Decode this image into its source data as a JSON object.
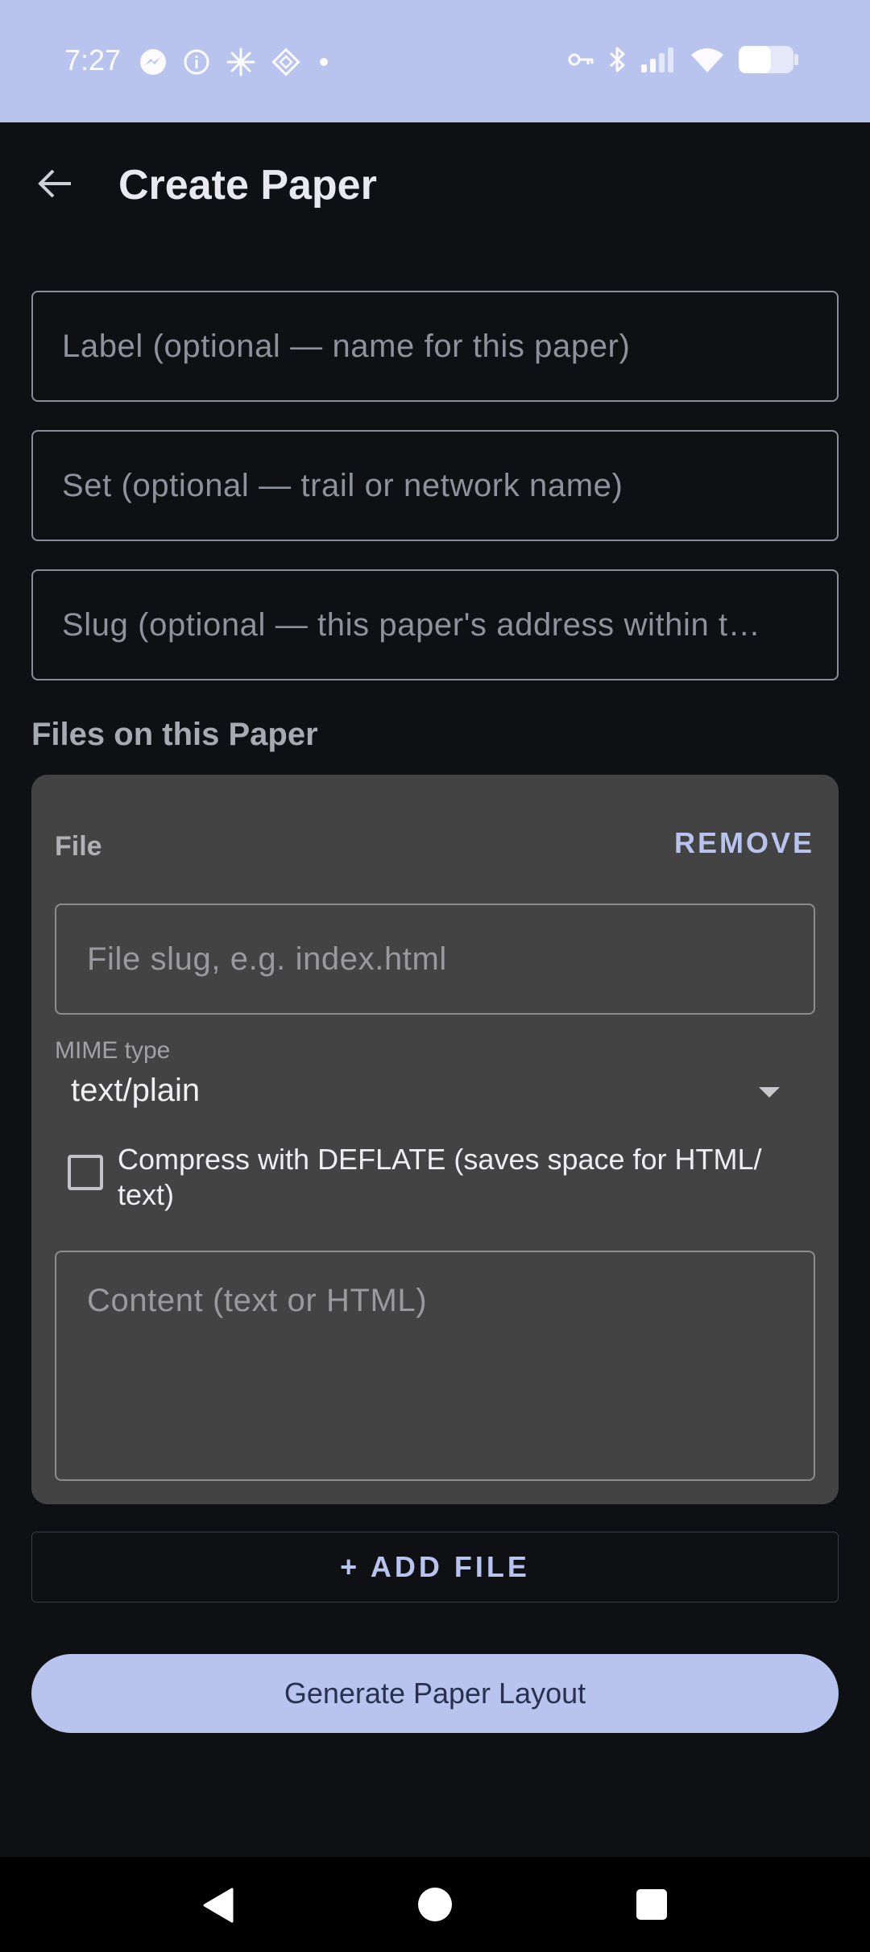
{
  "status_bar": {
    "time": "7:27",
    "left_icons": [
      "messenger-icon",
      "info-icon",
      "sparkle-icon",
      "diamond-icon",
      "dot-icon"
    ],
    "right_icons": [
      "vpn-key-icon",
      "bluetooth-icon",
      "signal-icon",
      "wifi-icon",
      "battery-icon"
    ]
  },
  "app_bar": {
    "title": "Create Paper",
    "back_icon": "arrow-left-icon"
  },
  "form": {
    "label_placeholder": "Label (optional — name for this paper)",
    "set_placeholder": "Set (optional — trail or network name)",
    "slug_placeholder": "Slug (optional — this paper's address within t…"
  },
  "files_section": {
    "title": "Files on this Paper",
    "file": {
      "heading": "File",
      "remove_label": "REMOVE",
      "slug_placeholder": "File slug, e.g. index.html",
      "mime_label": "MIME type",
      "mime_value": "text/plain",
      "compress_label": "Compress with DEFLATE (saves space for HTML/ text)",
      "compress_checked": false,
      "content_placeholder": "Content (text or HTML)"
    },
    "add_file_label": "+ ADD FILE"
  },
  "actions": {
    "generate_label": "Generate Paper Layout"
  },
  "colors": {
    "accent": "#b8c4ee",
    "background": "#0f1014",
    "card": "#434343"
  }
}
